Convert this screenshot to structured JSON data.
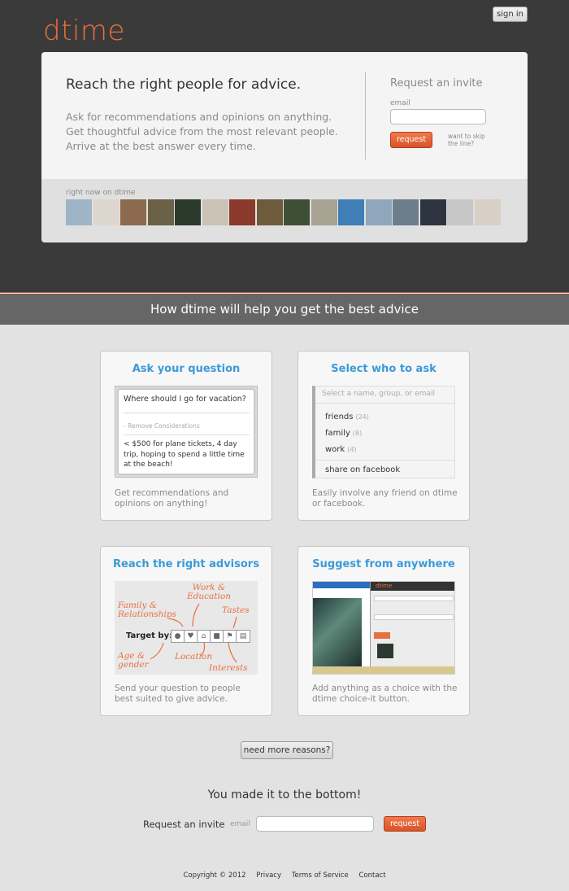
{
  "header": {
    "logo": "dtime",
    "signin_label": "sign in"
  },
  "hero": {
    "title": "Reach the right people for advice.",
    "desc_lines": [
      "Ask for recommendations and opinions on anything.",
      "Get thoughtful advice from the most relevant people.",
      "Arrive at the best answer every time."
    ],
    "invite_title": "Request an invite",
    "email_label": "email",
    "email_value": "",
    "request_label": "request",
    "skip_text": "want to skip the line?",
    "strip_label": "right now on dtime",
    "thumb_colors": [
      "#9fb4c6",
      "#dcd6cf",
      "#8c6a4e",
      "#6b6147",
      "#2b3a2b",
      "#c9c2b5",
      "#8a3a2a",
      "#6e5b3c",
      "#3f4f36",
      "#a8a393",
      "#3f7fb5",
      "#8fa6bd",
      "#6c7d8c",
      "#2d3440",
      "#c7c7c7",
      "#d8cfc6"
    ]
  },
  "band_title": "How dtime will help you get the best advice",
  "cards": {
    "ask": {
      "title": "Ask your question",
      "question": "Where should I go for vacation?",
      "remove": "- Remove Considerations",
      "consideration": "< $500 for plane tickets, 4 day trip, hoping to spend a little time at the beach!",
      "desc": "Get recommendations and opinions on anything!"
    },
    "select": {
      "title": "Select who to ask",
      "placeholder": "Select a name, group, or email",
      "items": [
        {
          "label": "friends",
          "count": "(24)"
        },
        {
          "label": "family",
          "count": "(8)"
        },
        {
          "label": "work",
          "count": "(4)"
        }
      ],
      "facebook": "share on facebook",
      "desc": "Easily involve any friend on dtime or facebook."
    },
    "advisors": {
      "title": "Reach the right advisors",
      "labels": {
        "work": "Work & Education",
        "family": "Family & Relationships",
        "tastes": "Tastes",
        "target": "Target by:",
        "age": "Age & gender",
        "location": "Location",
        "interests": "Interests"
      },
      "desc": "Send your question to people best suited to give advice."
    },
    "suggest": {
      "title": "Suggest from anywhere",
      "screenshot_brand": "dtime",
      "desc": "Add anything as a choice with the dtime choice-it button."
    }
  },
  "more_reasons": "need more reasons?",
  "bottom": {
    "title": "You made it to the bottom!",
    "request_invite": "Request an invite",
    "email_label": "email",
    "email_value": "",
    "request_label": "request"
  },
  "footer": {
    "copyright": "Copyright © 2012",
    "privacy": "Privacy",
    "terms": "Terms of Service",
    "contact": "Contact"
  }
}
